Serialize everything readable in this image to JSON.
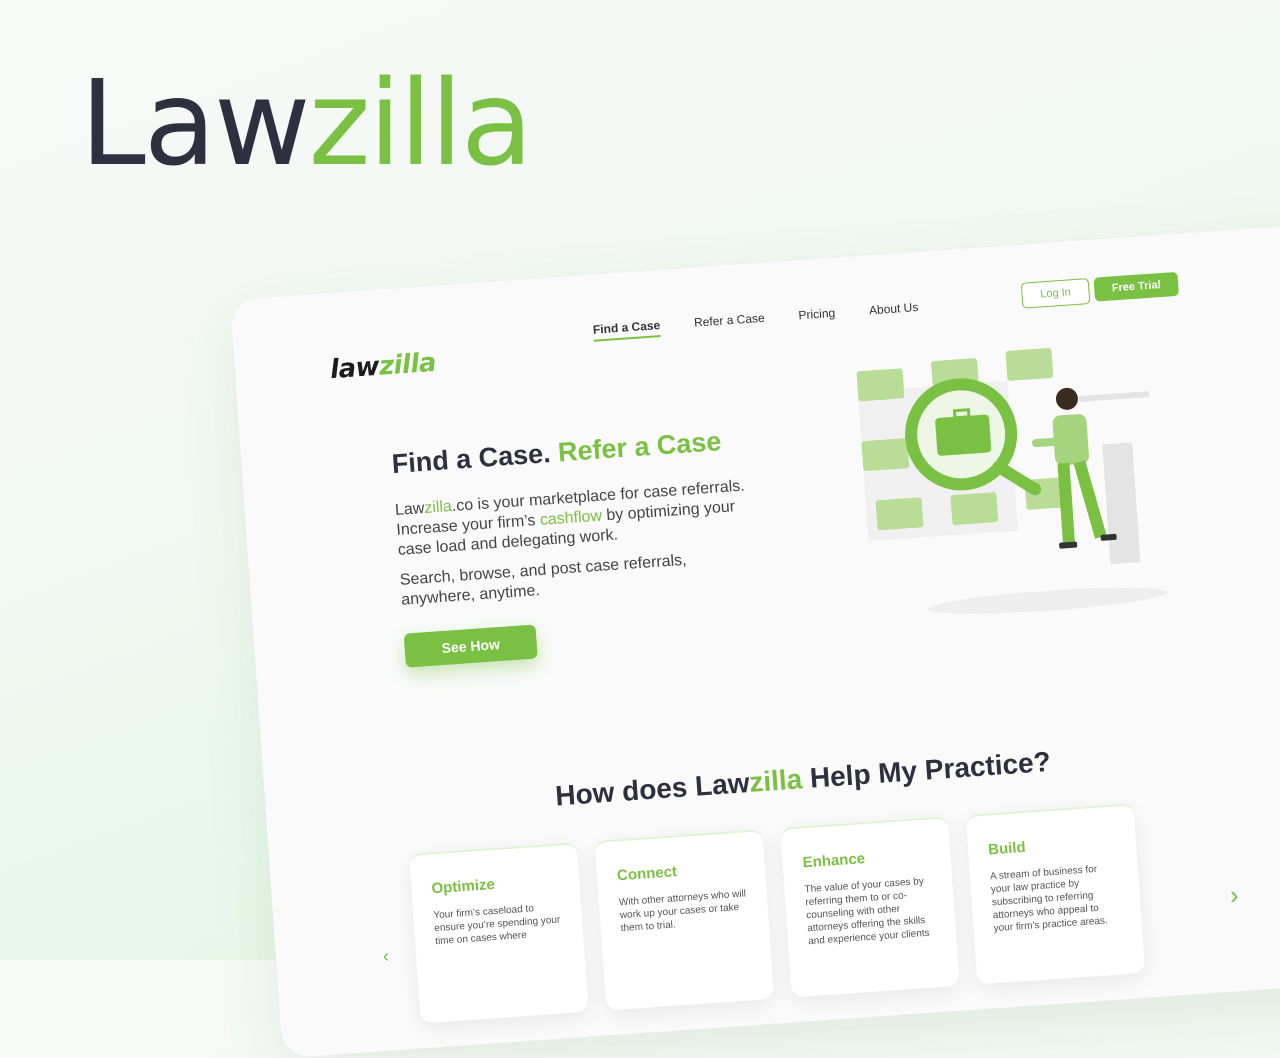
{
  "brand": {
    "part1": "Law",
    "part2": "zilla"
  },
  "site": {
    "logo": {
      "part1": "law",
      "part2": "zilla"
    },
    "nav": [
      {
        "label": "Find a Case"
      },
      {
        "label": "Refer a Case"
      },
      {
        "label": "Pricing"
      },
      {
        "label": "About Us"
      }
    ],
    "login_label": "Log In",
    "trial_label": "Free Trial"
  },
  "hero": {
    "title1": "Find a Case. ",
    "title2": "Refer a Case",
    "p1_a": "Law",
    "p1_b": "zilla",
    "p1_c": ".co is your marketplace for case referrals. Increase your firm’s ",
    "p1_d": "cashflow",
    "p1_e": " by optimizing your case load and delegating work.",
    "p2": "Search, browse, and post case referrals, anywhere, anytime.",
    "cta_label": "See How"
  },
  "how": {
    "title1": "How does Law",
    "title2": "zilla",
    "title3": " Help My Practice?",
    "cards": [
      {
        "title": "Optimize",
        "text": "Your firm’s caseload to ensure you’re spending your time on cases where"
      },
      {
        "title": "Connect",
        "text": "With other attorneys who will work up your cases or take them to trial."
      },
      {
        "title": "Enhance",
        "text": "The value of your cases by referring them to or co-counseling with other attorneys offering the skills and experience your clients"
      },
      {
        "title": "Build",
        "text": "A stream of business for your law practice by subscribing to referring attorneys who appeal to your firm’s practice areas."
      }
    ]
  },
  "colors": {
    "accent": "#7ac143",
    "dark": "#2f2f3f"
  },
  "icons": {
    "next": "chevron-right-icon",
    "prev": "chevron-left-icon"
  }
}
